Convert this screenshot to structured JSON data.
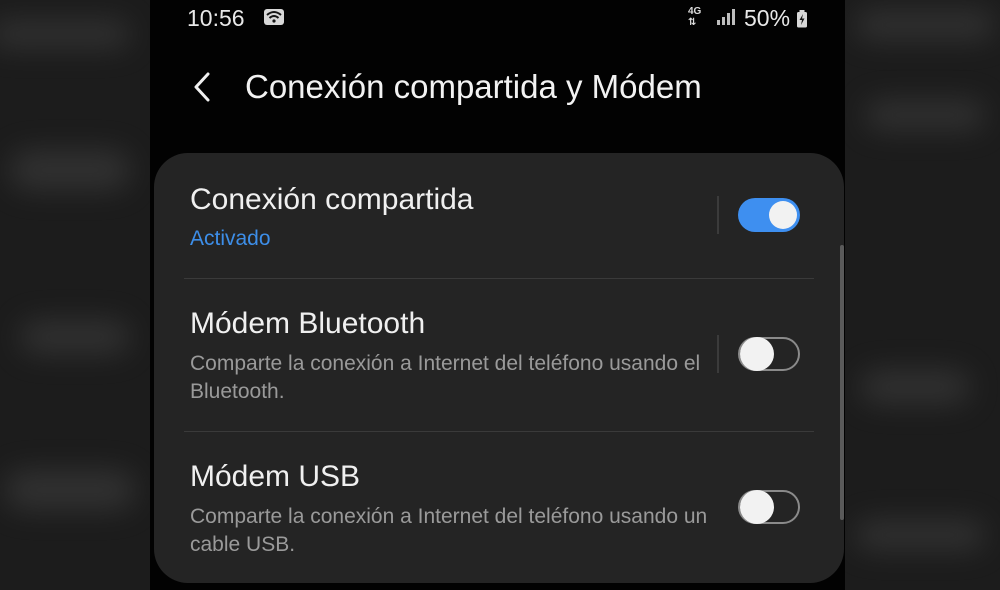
{
  "status_bar": {
    "time": "10:56",
    "network_type": "4G",
    "battery": "50%"
  },
  "header": {
    "title": "Conexión compartida y Módem"
  },
  "settings": [
    {
      "title": "Conexión compartida",
      "status": "Activado",
      "enabled": true
    },
    {
      "title": "Módem Bluetooth",
      "description": "Comparte la conexión a Internet del teléfono usando el Bluetooth.",
      "enabled": false
    },
    {
      "title": "Módem USB",
      "description": "Comparte la conexión a Internet del teléfono usando un cable USB.",
      "enabled": false
    }
  ],
  "colors": {
    "accent": "#3e8ff0",
    "card_background": "#242424",
    "background": "#020202"
  },
  "icons": {
    "wifi": "wifi-icon",
    "signal": "signal-icon",
    "battery": "battery-charging-icon",
    "back": "back-chevron-icon"
  }
}
